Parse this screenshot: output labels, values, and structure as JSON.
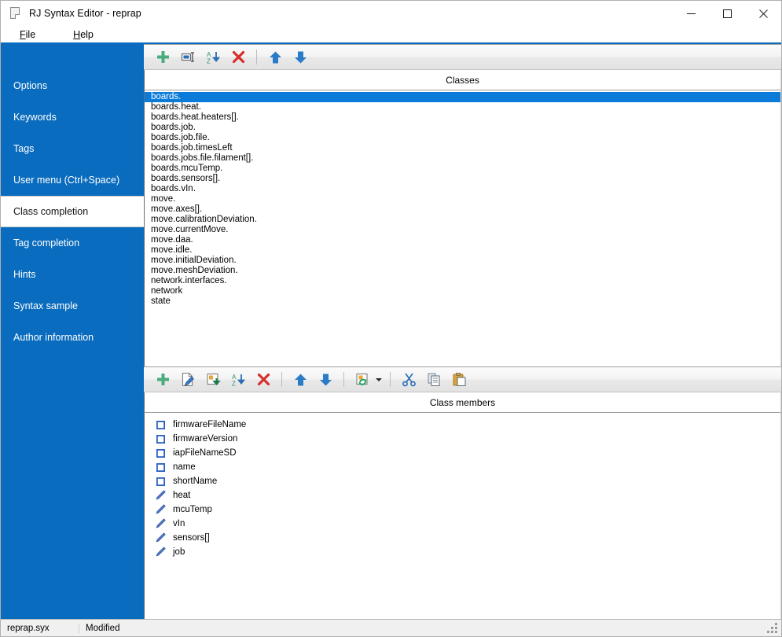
{
  "window": {
    "title": "RJ Syntax Editor - reprap",
    "icon": "document-icon",
    "controls": [
      {
        "name": "minimize",
        "label": "—"
      },
      {
        "name": "maximize",
        "label": "□"
      },
      {
        "name": "close",
        "label": "✕"
      }
    ]
  },
  "menubar": {
    "items": [
      {
        "label": "File",
        "accel": "F",
        "rest": "ile"
      },
      {
        "label": "Help",
        "accel": "H",
        "rest": "elp"
      }
    ]
  },
  "sidebar": {
    "items": [
      {
        "label": "Options",
        "selected": false
      },
      {
        "label": "Keywords",
        "selected": false
      },
      {
        "label": "Tags",
        "selected": false
      },
      {
        "label": "User menu (Ctrl+Space)",
        "selected": false
      },
      {
        "label": "Class completion",
        "selected": true
      },
      {
        "label": "Tag completion",
        "selected": false
      },
      {
        "label": "Hints",
        "selected": false
      },
      {
        "label": "Syntax sample",
        "selected": false
      },
      {
        "label": "Author information",
        "selected": false
      }
    ]
  },
  "classes_toolbar": {
    "buttons": [
      {
        "name": "add-class-button",
        "icon": "plus-icon",
        "title": "Add"
      },
      {
        "name": "rename-class-button",
        "icon": "rename-icon",
        "title": "Rename"
      },
      {
        "name": "sort-classes-button",
        "icon": "sort-az-icon",
        "title": "Sort A-Z"
      },
      {
        "name": "delete-class-button",
        "icon": "delete-x-icon",
        "title": "Delete"
      },
      {
        "name": "separator-1",
        "icon": "separator",
        "title": ""
      },
      {
        "name": "move-class-up-button",
        "icon": "arrow-up-icon",
        "title": "Move up"
      },
      {
        "name": "move-class-down-button",
        "icon": "arrow-down-icon",
        "title": "Move down"
      }
    ]
  },
  "classes_panel": {
    "header": "Classes",
    "items": [
      {
        "label": "boards.",
        "selected": true
      },
      {
        "label": "boards.heat.",
        "selected": false
      },
      {
        "label": "boards.heat.heaters[].",
        "selected": false
      },
      {
        "label": "boards.job.",
        "selected": false
      },
      {
        "label": "boards.job.file.",
        "selected": false
      },
      {
        "label": "boards.job.timesLeft",
        "selected": false
      },
      {
        "label": "boards.jobs.file.filament[].",
        "selected": false
      },
      {
        "label": "boards.mcuTemp.",
        "selected": false
      },
      {
        "label": "boards.sensors[].",
        "selected": false
      },
      {
        "label": "boards.vIn.",
        "selected": false
      },
      {
        "label": "move.",
        "selected": false
      },
      {
        "label": "move.axes[].",
        "selected": false
      },
      {
        "label": "move.calibrationDeviation.",
        "selected": false
      },
      {
        "label": "move.currentMove.",
        "selected": false
      },
      {
        "label": "move.daa.",
        "selected": false
      },
      {
        "label": "move.idle.",
        "selected": false
      },
      {
        "label": "move.initialDeviation.",
        "selected": false
      },
      {
        "label": "move.meshDeviation.",
        "selected": false
      },
      {
        "label": "network.interfaces.",
        "selected": false
      },
      {
        "label": "network",
        "selected": false
      },
      {
        "label": "state",
        "selected": false
      }
    ]
  },
  "members_toolbar": {
    "buttons": [
      {
        "name": "add-member-button",
        "icon": "plus-icon",
        "title": "Add"
      },
      {
        "name": "edit-member-button",
        "icon": "edit-pencil-icon",
        "title": "Edit"
      },
      {
        "name": "import-member-button",
        "icon": "import-icon",
        "title": "Import"
      },
      {
        "name": "sort-members-button",
        "icon": "sort-az-icon",
        "title": "Sort A-Z"
      },
      {
        "name": "delete-member-button",
        "icon": "delete-x-icon",
        "title": "Delete"
      },
      {
        "name": "separator-1",
        "icon": "separator",
        "title": ""
      },
      {
        "name": "move-member-up-button",
        "icon": "arrow-up-icon",
        "title": "Move up"
      },
      {
        "name": "move-member-down-button",
        "icon": "arrow-down-icon",
        "title": "Move down"
      },
      {
        "name": "separator-2",
        "icon": "separator",
        "title": ""
      },
      {
        "name": "refresh-members-button",
        "icon": "refresh-icon",
        "title": "Refresh"
      },
      {
        "name": "refresh-dropdown-button",
        "icon": "chevron-down-icon",
        "title": "More"
      },
      {
        "name": "separator-3",
        "icon": "separator",
        "title": ""
      },
      {
        "name": "cut-button",
        "icon": "scissors-icon",
        "title": "Cut"
      },
      {
        "name": "copy-button",
        "icon": "copy-icon",
        "title": "Copy"
      },
      {
        "name": "paste-button",
        "icon": "paste-icon",
        "title": "Paste"
      }
    ]
  },
  "members_panel": {
    "header": "Class members",
    "items": [
      {
        "label": "firmwareFileName",
        "icon": "property-box-icon"
      },
      {
        "label": "firmwareVersion",
        "icon": "property-box-icon"
      },
      {
        "label": "iapFileNameSD",
        "icon": "property-box-icon"
      },
      {
        "label": "name",
        "icon": "property-box-icon"
      },
      {
        "label": "shortName",
        "icon": "property-box-icon"
      },
      {
        "label": "heat",
        "icon": "pencil-member-icon"
      },
      {
        "label": "mcuTemp",
        "icon": "pencil-member-icon"
      },
      {
        "label": "vIn",
        "icon": "pencil-member-icon"
      },
      {
        "label": "sensors[]",
        "icon": "pencil-member-icon"
      },
      {
        "label": "job",
        "icon": "pencil-member-icon"
      }
    ]
  },
  "statusbar": {
    "filename": "reprap.syx",
    "state": "Modified",
    "grip": "resize-grip-icon"
  },
  "colors": {
    "accent_blue": "#0a6cbe",
    "selection_blue": "#0a7bd8",
    "icon_green": "#4aab7e",
    "icon_red": "#d6302c",
    "icon_blue": "#2a7cc7",
    "toolbar_bg": "#eeeeee"
  }
}
